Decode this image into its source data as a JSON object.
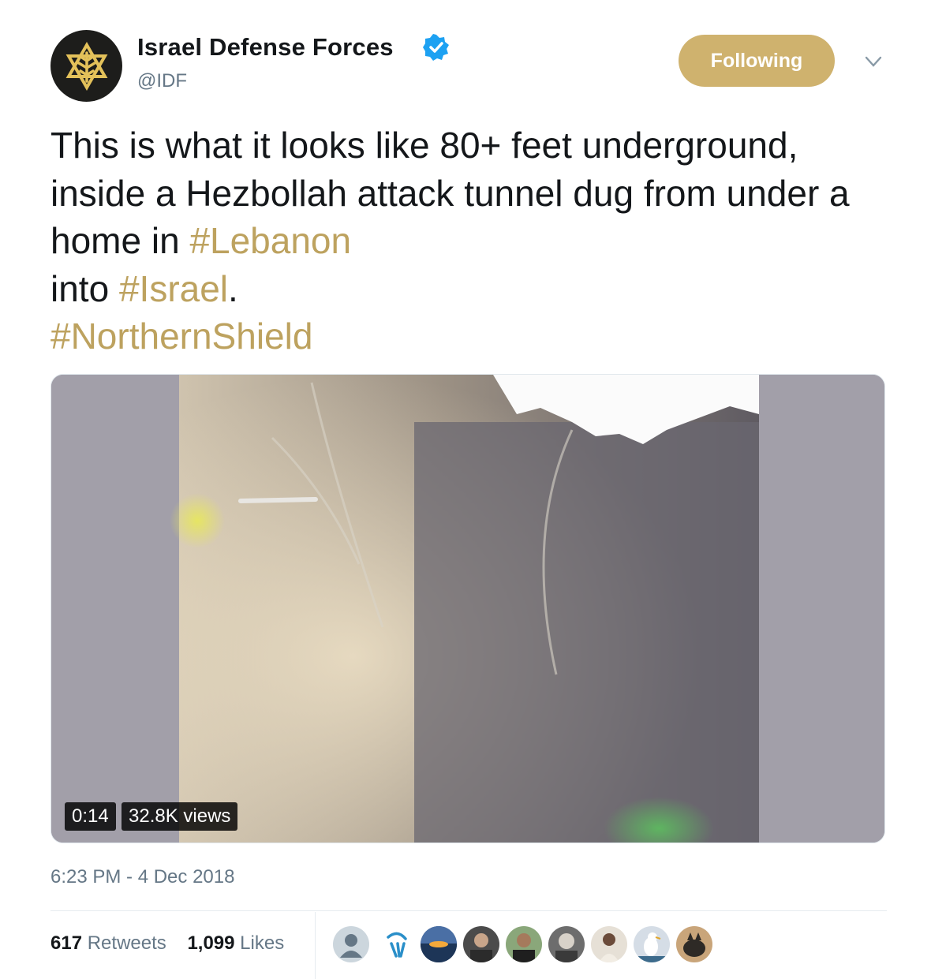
{
  "account": {
    "display_name": "Israel Defense Forces",
    "handle": "@IDF",
    "verified": true,
    "avatar_icon": "idf-emblem-icon"
  },
  "follow_button": {
    "label": "Following",
    "color": "#cfb26e"
  },
  "tweet": {
    "text_plain": "This is what it looks like 80+ feet underground, inside a Hezbollah attack tunnel dug from under a home in ",
    "hashtag_lebanon": "#Lebanon",
    "text_into": "into ",
    "hashtag_israel": "#Israel",
    "text_period": ".",
    "hashtag_northernshield": "#NorthernShield",
    "hashtag_color": "#bda25f"
  },
  "media": {
    "duration": "0:14",
    "views": "32.8K views"
  },
  "timestamp": "6:23 PM - 4 Dec 2018",
  "stats": {
    "retweets_count": "617",
    "retweets_label": "Retweets",
    "likes_count": "1,099",
    "likes_label": "Likes"
  },
  "likers": [
    {
      "icon": "default-avatar-icon"
    },
    {
      "icon": "logo-avatar-icon"
    },
    {
      "icon": "sunset-avatar-icon"
    },
    {
      "icon": "person-avatar-icon"
    },
    {
      "icon": "person-avatar-icon"
    },
    {
      "icon": "person-avatar-icon"
    },
    {
      "icon": "person-avatar-icon"
    },
    {
      "icon": "seagull-avatar-icon"
    },
    {
      "icon": "animal-avatar-icon"
    }
  ]
}
